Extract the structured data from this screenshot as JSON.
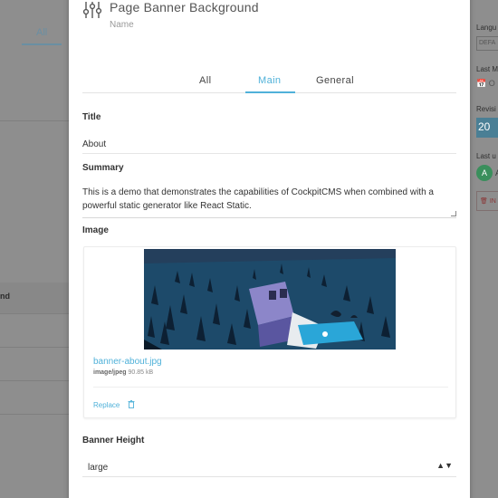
{
  "background": {
    "left": {
      "tab_all": "All",
      "row_label": "nd"
    },
    "right": {
      "language_label": "Langu",
      "language_value": "DEFA",
      "last_modified_label": "Last M",
      "last_modified_value": "O",
      "revisions_label": "Revisi",
      "revisions_value": "20",
      "last_updated_label": "Last u",
      "avatar_letter": "A",
      "avatar_name": "A",
      "info_button": "🗑 IN"
    }
  },
  "modal": {
    "title": "Page Banner Background",
    "subtitle": "Name",
    "close": "✖",
    "icon": "sliders-icon",
    "tabs": [
      "All",
      "Main",
      "General"
    ],
    "active_tab": "Main"
  },
  "fields": {
    "title": {
      "label": "Title",
      "value": "About"
    },
    "summary": {
      "label": "Summary",
      "value": "This is a demo that demonstrates the capabilities of CockpitCMS when combined with a powerful static generator like React Static."
    },
    "image": {
      "label": "Image",
      "filename": "banner-about.jpg",
      "mime": "image/jpeg",
      "size": "90.85 kB",
      "replace_label": "Replace",
      "delete_icon": "trash-icon"
    },
    "banner_height": {
      "label": "Banner Height",
      "value": "large",
      "arrows": "▲▼"
    }
  },
  "colors": {
    "accent": "#4fb1d9",
    "text": "#333333",
    "overlay": "#8f8f8f"
  }
}
